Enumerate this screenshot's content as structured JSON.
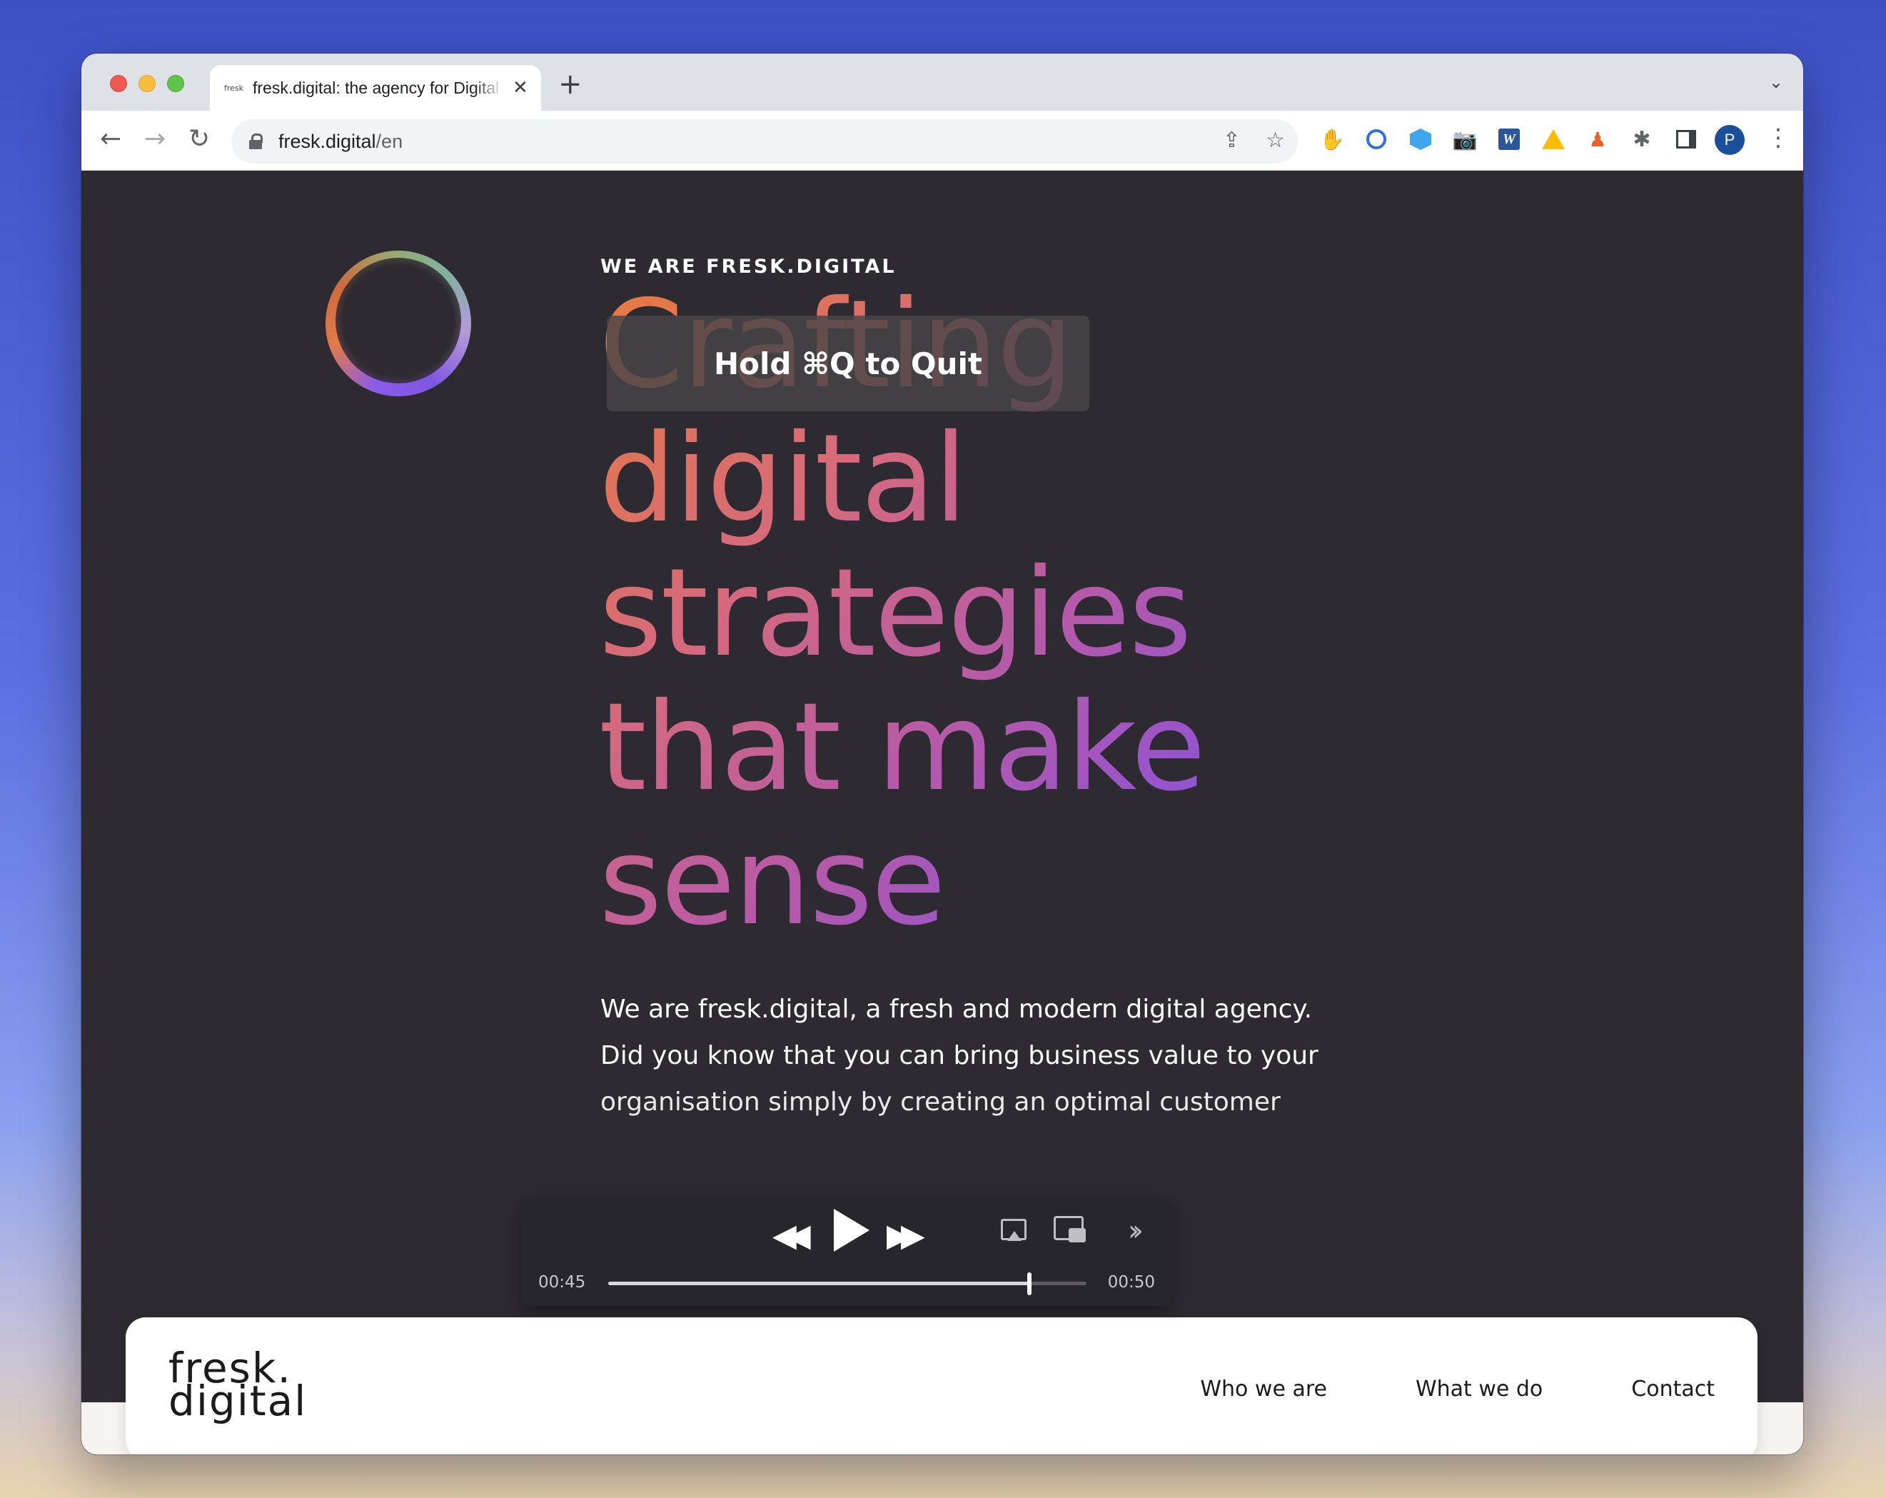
{
  "browser": {
    "tab": {
      "favicon_text": "fresk",
      "title": "fresk.digital: the agency for Digital",
      "close_icon": "close-icon"
    },
    "new_tab_icon": "plus-icon",
    "tab_list_icon": "chevron-down-icon",
    "nav": {
      "back_icon": "arrow-left-icon",
      "forward_icon": "arrow-right-icon",
      "reload_icon": "reload-icon"
    },
    "address": {
      "host": "fresk.digital",
      "path": "/en"
    },
    "avatar_letter": "P",
    "extensions": [
      "hand-icon",
      "lens-icon",
      "hexagon-icon",
      "camera-icon",
      "word-icon",
      "drive-icon",
      "figure-icon",
      "puzzle-icon",
      "sidepanel-icon"
    ]
  },
  "hero": {
    "eyebrow": "WE ARE FRESK.DIGITAL",
    "headline_lines": [
      "Crafting",
      "digital",
      "strategies",
      "that make",
      "sense"
    ],
    "intro_lines": [
      "We are fresk.digital, a fresh and modern digital agency.",
      "Did you know that you can bring business value to your",
      "organisation simply by creating an optimal customer"
    ]
  },
  "overlay": {
    "quit_hud": "Hold ⌘Q to Quit"
  },
  "media": {
    "current_time": "00:45",
    "duration": "00:50",
    "progress": 0.88
  },
  "site_nav": {
    "logo_line1": "fresk.",
    "logo_line2": "digital",
    "links": [
      "Who we are",
      "What we do",
      "Contact"
    ]
  },
  "colors": {
    "page_bg": "#2d2a31",
    "headline_gradient_start": "#e67c3c",
    "headline_gradient_end": "#7a4be0",
    "desktop_bg": "#3d51c7"
  }
}
